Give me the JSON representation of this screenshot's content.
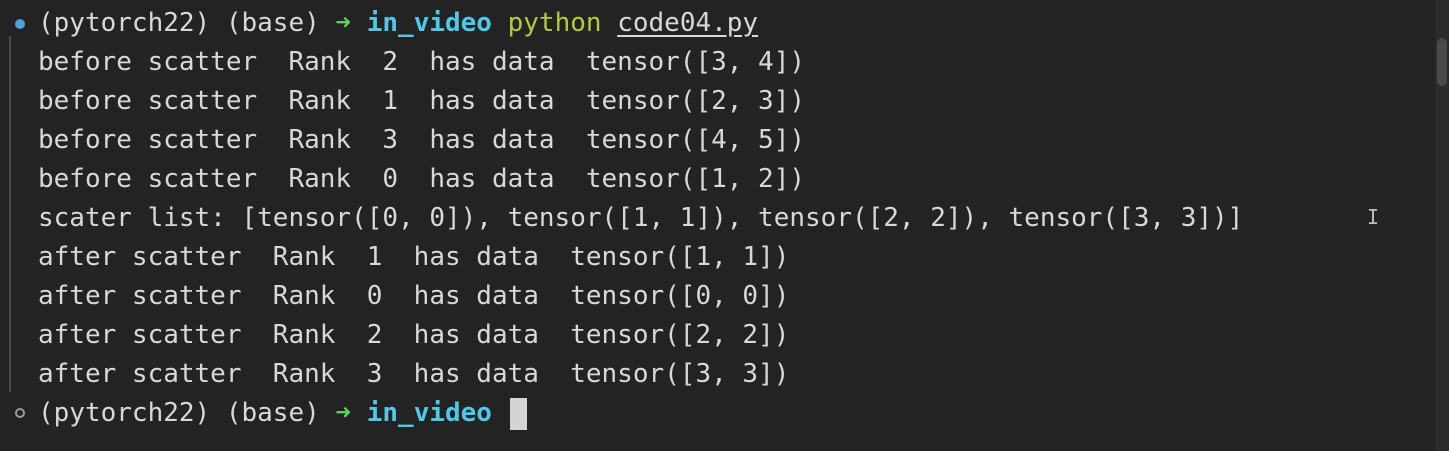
{
  "prompt": {
    "env1": "(pytorch22)",
    "env2": "(base)",
    "arrow": "➜",
    "directory": "in_video",
    "command": "python",
    "argument": "code04.py"
  },
  "output_lines": [
    "before scatter  Rank  2  has data  tensor([3, 4])",
    "before scatter  Rank  1  has data  tensor([2, 3])",
    "before scatter  Rank  3  has data  tensor([4, 5])",
    "before scatter  Rank  0  has data  tensor([1, 2])",
    "scater list: [tensor([0, 0]), tensor([1, 1]), tensor([2, 2]), tensor([3, 3])]",
    "after scatter  Rank  1  has data  tensor([1, 1])",
    "after scatter  Rank  0  has data  tensor([0, 0])",
    "after scatter  Rank  2  has data  tensor([2, 2])",
    "after scatter  Rank  3  has data  tensor([3, 3])"
  ],
  "next_prompt": {
    "env1": "(pytorch22)",
    "env2": "(base)",
    "arrow": "➜",
    "directory": "in_video"
  },
  "colors": {
    "background": "#232323",
    "text": "#d8d8d8",
    "arrow": "#5cd35a",
    "directory": "#4ec9e8",
    "command": "#b6c83c",
    "marker_success": "#4aa3d8"
  },
  "icons": {
    "prompt_marker_1": "filled-circle-icon",
    "prompt_marker_2": "hollow-circle-icon",
    "mouse_cursor": "text-ibeam-cursor-icon"
  }
}
